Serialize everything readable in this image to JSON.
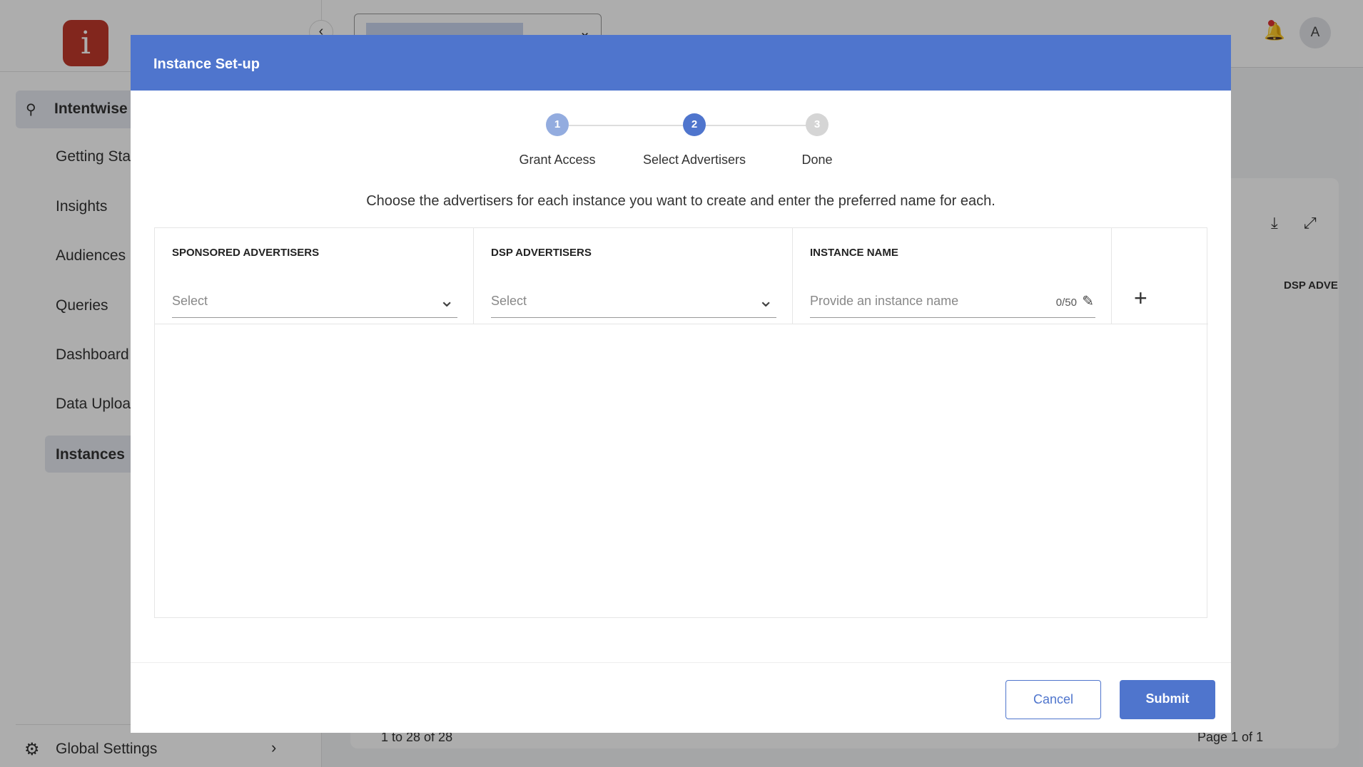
{
  "app": {
    "logo_letter": "i"
  },
  "sidebar": {
    "items": [
      {
        "label": "Intentwise"
      },
      {
        "label": "Getting Started"
      },
      {
        "label": "Insights"
      },
      {
        "label": "Audiences"
      },
      {
        "label": "Queries"
      },
      {
        "label": "Dashboard"
      },
      {
        "label": "Data Upload"
      },
      {
        "label": "Instances"
      }
    ],
    "footer": {
      "label": "Global Settings"
    }
  },
  "topbar": {
    "avatar": "A"
  },
  "background": {
    "column_header": "DSP ADVE",
    "pagination_range": "1 to 28 of 28",
    "page_label": "Page 1 of 1"
  },
  "modal": {
    "title": "Instance Set-up",
    "steps": [
      {
        "num": "1",
        "label": "Grant Access"
      },
      {
        "num": "2",
        "label": "Select Advertisers"
      },
      {
        "num": "3",
        "label": "Done"
      }
    ],
    "description": "Choose the advertisers for each instance you want to create and enter the preferred name for each.",
    "columns": [
      "SPONSORED ADVERTISERS",
      "DSP ADVERTISERS",
      "INSTANCE NAME"
    ],
    "sponsored_placeholder": "Select",
    "dsp_placeholder": "Select",
    "name_placeholder": "Provide an instance name",
    "char_count": "0/50",
    "cancel": "Cancel",
    "submit": "Submit"
  },
  "colors": {
    "primary": "#4f75cd",
    "step_done": "#93acdf",
    "step_todo": "#d5d5d5"
  }
}
